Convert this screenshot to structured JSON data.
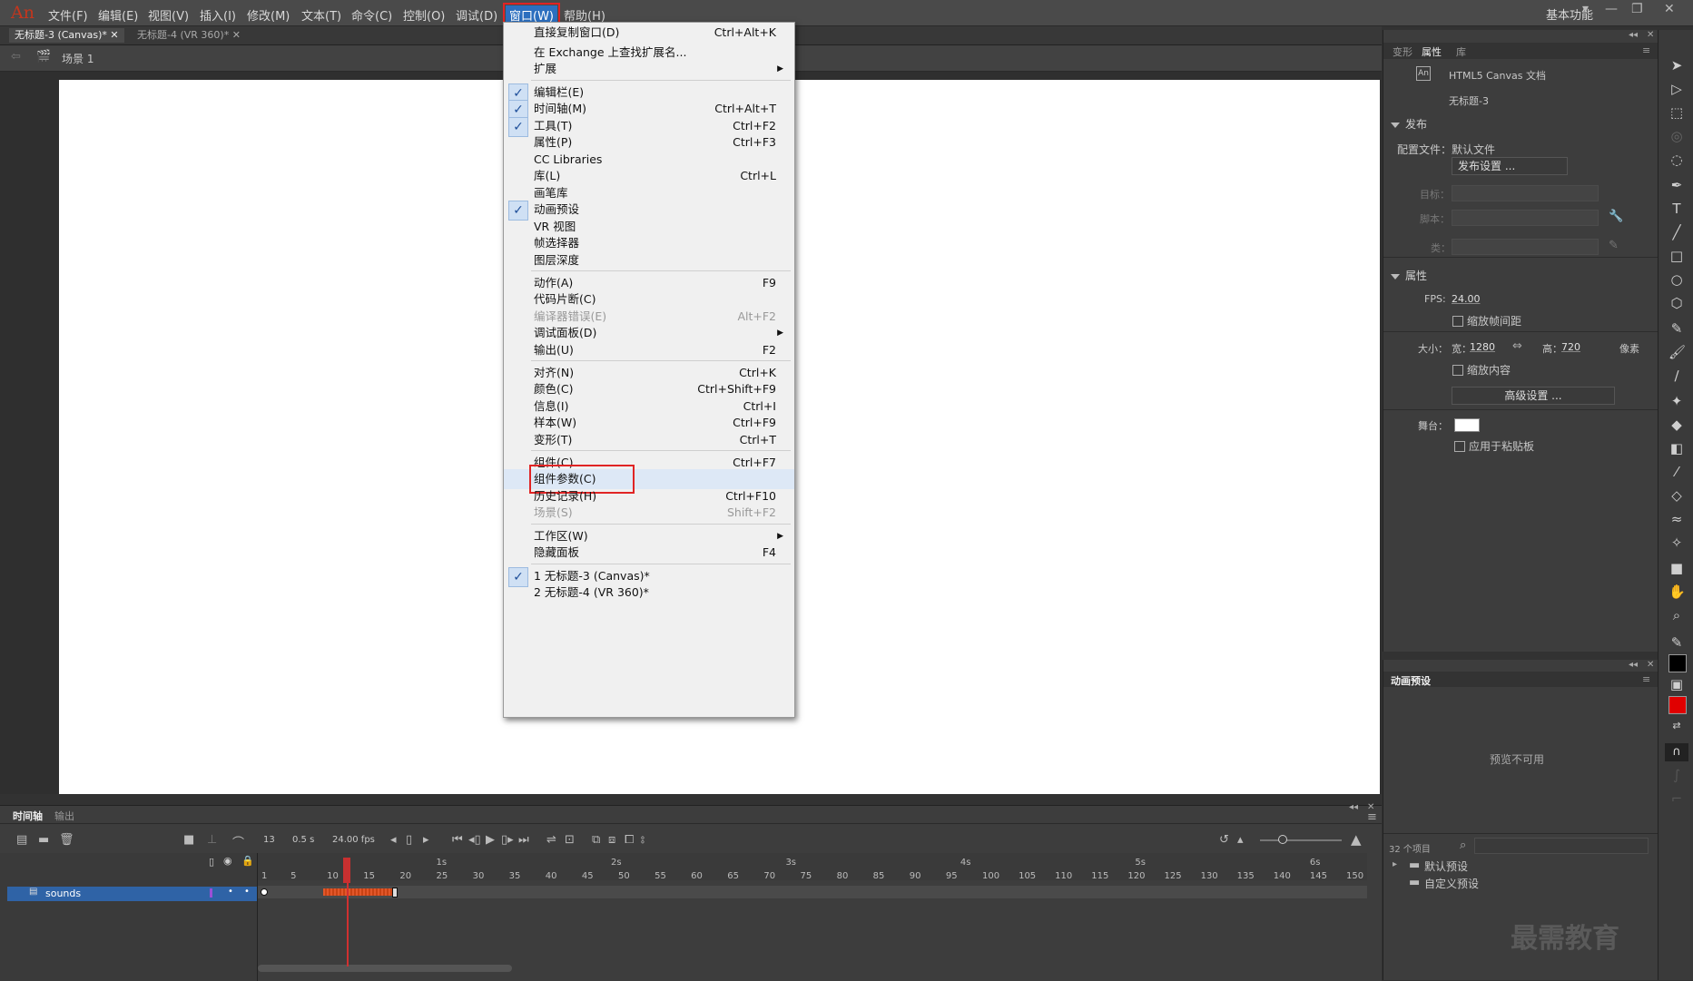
{
  "app": {
    "logo": "An"
  },
  "menubar": {
    "items": [
      "文件(F)",
      "编辑(E)",
      "视图(V)",
      "插入(I)",
      "修改(M)",
      "文本(T)",
      "命令(C)",
      "控制(O)",
      "调试(D)",
      "窗口(W)",
      "帮助(H)"
    ],
    "active_item": "窗口(W)",
    "workspace": "基本功能"
  },
  "tabs": [
    {
      "label": "无标题-3 (Canvas)*",
      "active": true
    },
    {
      "label": "无标题-4 (VR 360)*",
      "active": false
    }
  ],
  "scene": {
    "label": "场景 1"
  },
  "window_menu": {
    "items": [
      {
        "label": "直接复制窗口(D)",
        "shortcut": "Ctrl+Alt+K"
      },
      {
        "label": "在 Exchange 上查找扩展名..."
      },
      {
        "label": "扩展",
        "submenu": true
      },
      {
        "label": "编辑栏(E)",
        "checked": true
      },
      {
        "label": "时间轴(M)",
        "shortcut": "Ctrl+Alt+T",
        "checked": true
      },
      {
        "label": "工具(T)",
        "shortcut": "Ctrl+F2",
        "checked": true
      },
      {
        "label": "属性(P)",
        "shortcut": "Ctrl+F3"
      },
      {
        "label": "CC Libraries"
      },
      {
        "label": "库(L)",
        "shortcut": "Ctrl+L"
      },
      {
        "label": "画笔库"
      },
      {
        "label": "动画预设",
        "checked": true
      },
      {
        "label": "VR 视图"
      },
      {
        "label": "帧选择器"
      },
      {
        "label": "图层深度"
      },
      {
        "label": "动作(A)",
        "shortcut": "F9"
      },
      {
        "label": "代码片断(C)"
      },
      {
        "label": "编译器错误(E)",
        "shortcut": "Alt+F2",
        "disabled": true
      },
      {
        "label": "调试面板(D)",
        "submenu": true
      },
      {
        "label": "输出(U)",
        "shortcut": "F2"
      },
      {
        "label": "对齐(N)",
        "shortcut": "Ctrl+K"
      },
      {
        "label": "颜色(C)",
        "shortcut": "Ctrl+Shift+F9"
      },
      {
        "label": "信息(I)",
        "shortcut": "Ctrl+I"
      },
      {
        "label": "样本(W)",
        "shortcut": "Ctrl+F9"
      },
      {
        "label": "变形(T)",
        "shortcut": "Ctrl+T"
      },
      {
        "label": "组件(C)",
        "shortcut": "Ctrl+F7"
      },
      {
        "label": "组件参数(C)",
        "highlighted": true
      },
      {
        "label": "历史记录(H)",
        "shortcut": "Ctrl+F10"
      },
      {
        "label": "场景(S)",
        "shortcut": "Shift+F2",
        "disabled": true
      },
      {
        "label": "工作区(W)",
        "submenu": true
      },
      {
        "label": "隐藏面板",
        "shortcut": "F4"
      },
      {
        "label": "1 无标题-3 (Canvas)*",
        "checked": true
      },
      {
        "label": "2 无标题-4 (VR 360)*"
      }
    ]
  },
  "properties_panel": {
    "tabs": [
      "变形",
      "属性",
      "库"
    ],
    "active_tab": "属性",
    "doc_type": "HTML5 Canvas 文档",
    "doc_name": "无标题-3",
    "doc_icon": "An",
    "publish_section": "发布",
    "profile_label": "配置文件：",
    "profile_value": "默认文件",
    "publish_settings_button": "发布设置 ...",
    "target_label": "目标：",
    "script_label": "脚本：",
    "class_label": "类：",
    "properties_section": "属性",
    "fps_label": "FPS:",
    "fps_value": "24.00",
    "scale_spans_label": "缩放帧间距",
    "size_label": "大小：",
    "width_label": "宽：",
    "width_value": "1280",
    "height_label": "高：",
    "height_value": "720",
    "unit_label": "像素",
    "scale_content_label": "缩放内容",
    "advanced_button": "高级设置 ...",
    "stage_label": "舞台：",
    "apply_pasteboard_label": "应用于粘贴板"
  },
  "anim_presets_panel": {
    "title": "动画预设",
    "preview": "预览不可用",
    "count": "32 个项目",
    "folders": [
      "默认预设",
      "自定义预设"
    ]
  },
  "timeline": {
    "tabs": [
      "时间轴",
      "输出"
    ],
    "active_tab": "时间轴",
    "frame": "13",
    "time": "0.5 s",
    "fps": "24.00 fps",
    "layer_name": "sounds",
    "frame_ticks": [
      "1",
      "5",
      "10",
      "15",
      "20",
      "25",
      "30",
      "35",
      "40",
      "45",
      "50",
      "55",
      "60",
      "65",
      "70",
      "75",
      "80",
      "85",
      "90",
      "95",
      "100",
      "105",
      "110",
      "115",
      "120",
      "125",
      "130",
      "135",
      "140",
      "145",
      "150"
    ],
    "second_marks": [
      "1s",
      "2s",
      "3s",
      "4s",
      "5s",
      "6s"
    ]
  },
  "watermark": "最需教育",
  "colors": {
    "accent": "#2c6fbf",
    "highlight_box": "#e02424",
    "stroke": "#000000",
    "fill": "#e00000"
  }
}
